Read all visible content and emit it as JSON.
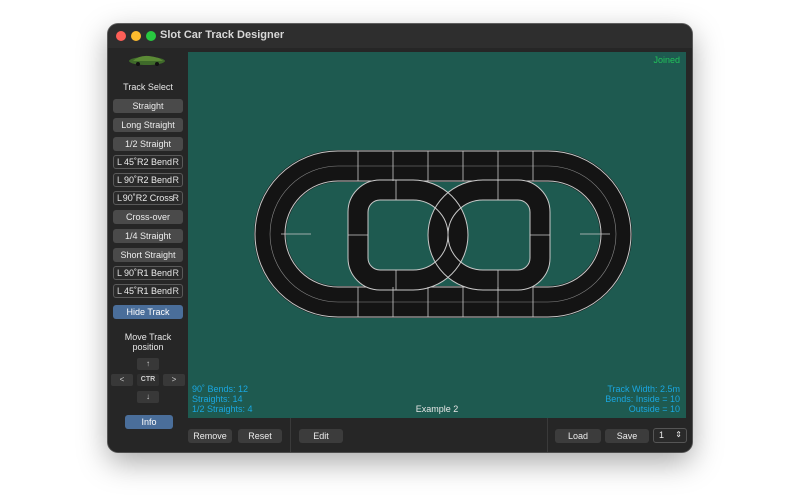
{
  "window": {
    "title": "Slot Car Track Designer"
  },
  "sidebar": {
    "track_select_label": "Track Select",
    "pieces": [
      {
        "label": "Straight"
      },
      {
        "label": "Long Straight"
      },
      {
        "label": "1/2 Straight"
      },
      {
        "label": "45˚R2 Bend",
        "left": "L",
        "right": "R"
      },
      {
        "label": "90˚R2 Bend",
        "left": "L",
        "right": "R"
      },
      {
        "label": "90˚R2 Cross",
        "left": "L",
        "right": "R"
      },
      {
        "label": "Cross-over"
      },
      {
        "label": "1/4 Straight"
      },
      {
        "label": "Short Straight"
      },
      {
        "label": "90˚R1 Bend",
        "left": "L",
        "right": "R"
      },
      {
        "label": "45˚R1 Bend",
        "left": "L",
        "right": "R"
      }
    ],
    "hide_track_label": "Hide Track",
    "move_label": "Move Track position",
    "arrows": {
      "up": "↑",
      "left": "<",
      "center": "CTR",
      "right": ">",
      "down": "↓"
    },
    "info_label": "Info"
  },
  "canvas": {
    "status": "Joined",
    "layout_name": "Example 2",
    "stats_left": [
      "90˚ Bends: 12",
      "Straights: 14",
      "1/2 Straights: 4"
    ],
    "stats_right": [
      "Track Width: 2.5m",
      "Bends: Inside = 10",
      "Outside = 10"
    ],
    "colors": {
      "background": "#1e5a50",
      "track": "#141414",
      "rail": "#c8c8c8",
      "status": "#22c25a",
      "stats": "#1aa6e0"
    }
  },
  "bottombar": {
    "remove_label": "Remove",
    "reset_label": "Reset",
    "edit_label": "Edit",
    "load_label": "Load",
    "save_label": "Save",
    "slot_value": "1"
  }
}
